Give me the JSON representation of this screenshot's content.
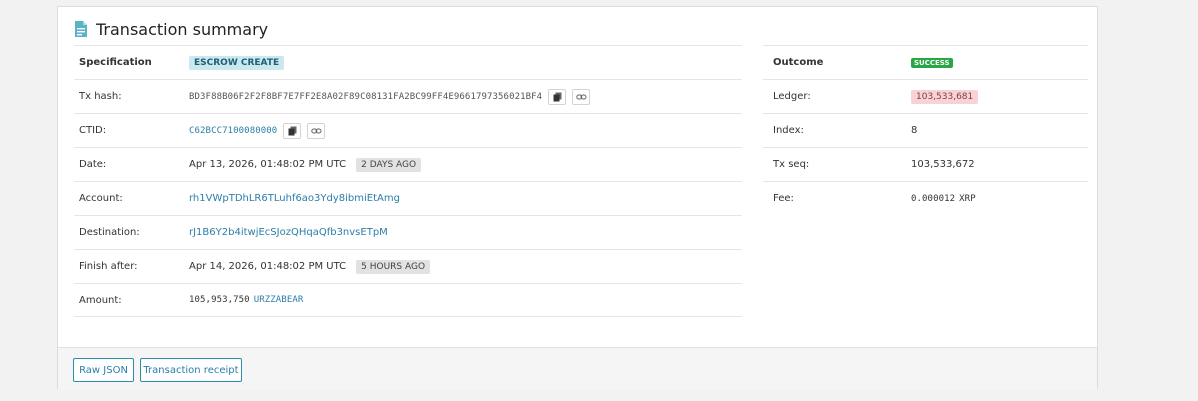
{
  "header": {
    "title": "Transaction summary",
    "icon": "document-icon"
  },
  "details": {
    "specification": {
      "label": "Specification",
      "value": "ESCROW CREATE"
    },
    "tx_hash": {
      "label": "Tx hash:",
      "value": "BD3F88B06F2F2F8BF7E7FF2E8A02F89C08131FA2BC99FF4E9661797356021BF4"
    },
    "ctid": {
      "label": "CTID:",
      "value": "C62BCC7100080000"
    },
    "date": {
      "label": "Date:",
      "value": "Apr 13, 2026, 01:48:02 PM UTC",
      "badge": "2 DAYS AGO"
    },
    "account": {
      "label": "Account:",
      "value": "rh1VWpTDhLR6TLuhf6ao3Ydy8ibmiEtAmg"
    },
    "destination": {
      "label": "Destination:",
      "value": "rJ1B6Y2b4itwjEcSJozQHqaQfb3nvsETpM"
    },
    "finish_after": {
      "label": "Finish after:",
      "value": "Apr 14, 2026, 01:48:02 PM UTC",
      "badge": "5 HOURS AGO"
    },
    "amount": {
      "label": "Amount:",
      "value": "105,953,750",
      "currency": "URZZABEAR"
    }
  },
  "outcome": {
    "outcome": {
      "label": "Outcome",
      "value": "SUCCESS"
    },
    "ledger": {
      "label": "Ledger:",
      "value": "103,533,681"
    },
    "index": {
      "label": "Index:",
      "value": "8"
    },
    "tx_seq": {
      "label": "Tx seq:",
      "value": "103,533,672"
    },
    "fee": {
      "label": "Fee:",
      "value": "0.000012",
      "currency": "XRP"
    }
  },
  "footer": {
    "raw_json": "Raw JSON",
    "receipt": "Transaction receipt"
  },
  "colors": {
    "accent": "#2a7fa8",
    "success": "#28a745",
    "ledger_bg": "#f7d3d6",
    "spec_bg": "#c9e8ef"
  }
}
